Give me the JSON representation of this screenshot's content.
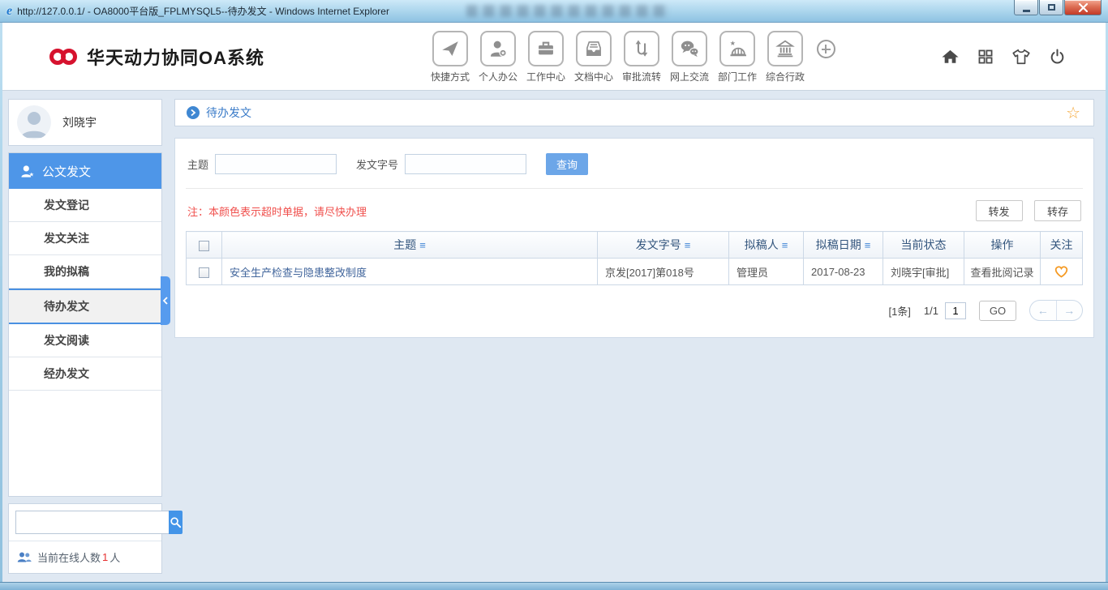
{
  "window": {
    "title": "http://127.0.0.1/ - OA8000平台版_FPLMYSQL5--待办发文 - Windows Internet Explorer"
  },
  "icons": {
    "ie_glyph": "e",
    "star_glyph": "☆",
    "sort_glyph": "≡",
    "prev_glyph": "←",
    "next_glyph": "→"
  },
  "header": {
    "logo_text": "华天动力协同OA系统",
    "nav_items": [
      {
        "label": "快捷方式"
      },
      {
        "label": "个人办公"
      },
      {
        "label": "工作中心"
      },
      {
        "label": "文档中心"
      },
      {
        "label": "审批流转"
      },
      {
        "label": "网上交流"
      },
      {
        "label": "部门工作"
      },
      {
        "label": "综合行政"
      }
    ]
  },
  "sidebar": {
    "user_name": "刘晓宇",
    "menu_title": "公文发文",
    "menu_items": [
      {
        "label": "发文登记"
      },
      {
        "label": "发文关注"
      },
      {
        "label": "我的拟稿"
      },
      {
        "label": "待办发文"
      },
      {
        "label": "发文阅读"
      },
      {
        "label": "经办发文"
      }
    ],
    "online_label": "当前在线人数",
    "online_count": "1",
    "online_suffix": "人"
  },
  "main": {
    "breadcrumb": "待办发文",
    "filters": {
      "subject_label": "主题",
      "docnum_label": "发文字号",
      "search_button": "查询"
    },
    "note": "注：本颜色表示超时单据，请尽快办理",
    "actions": {
      "forward": "转发",
      "transfer": "转存"
    },
    "table": {
      "headers": [
        "主题",
        "发文字号",
        "拟稿人",
        "拟稿日期",
        "当前状态",
        "操作",
        "关注"
      ],
      "rows": [
        {
          "subject": "安全生产检查与隐患整改制度",
          "doc_no": "京发[2017]第018号",
          "drafter": "管理员",
          "date": "2017-08-23",
          "status": "刘晓宇[审批]",
          "action": "查看批阅记录"
        }
      ]
    },
    "pagination": {
      "total": "[1条]",
      "page_info": "1/1",
      "page_input": "1",
      "go_label": "GO"
    }
  },
  "colors": {
    "accent_blue": "#4e96e8",
    "link_blue": "#3a7bc8",
    "note_red": "#f0504d",
    "favorite_orange": "#f59a23"
  }
}
